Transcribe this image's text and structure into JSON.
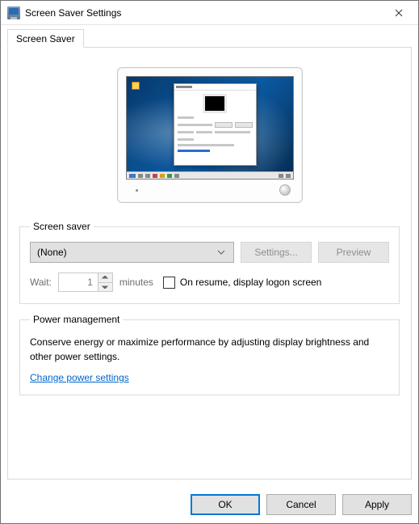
{
  "window": {
    "title": "Screen Saver Settings"
  },
  "tabs": {
    "screensaver": "Screen Saver"
  },
  "screensaver": {
    "legend": "Screen saver",
    "selected": "(None)",
    "settings_btn": "Settings...",
    "preview_btn": "Preview",
    "wait_label": "Wait:",
    "wait_value": "1",
    "wait_units": "minutes",
    "resume_label": "On resume, display logon screen"
  },
  "power": {
    "legend": "Power management",
    "text": "Conserve energy or maximize performance by adjusting display brightness and other power settings.",
    "link": "Change power settings"
  },
  "buttons": {
    "ok": "OK",
    "cancel": "Cancel",
    "apply": "Apply"
  }
}
